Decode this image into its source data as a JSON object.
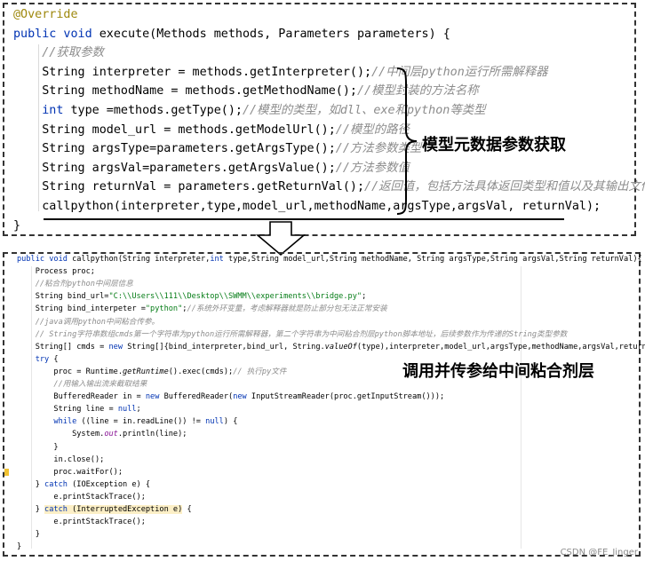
{
  "top": {
    "lines": [
      [
        {
          "c": "ann",
          "t": "@Override"
        }
      ],
      [
        {
          "c": "kw",
          "t": "public void "
        },
        {
          "c": "",
          "t": "execute(Methods methods, Parameters parameters) {"
        }
      ],
      [
        {
          "c": "",
          "t": "    "
        },
        {
          "c": "cm",
          "t": "//获取参数"
        }
      ],
      [
        {
          "c": "",
          "t": "    String interpreter = methods.getInterpreter();"
        },
        {
          "c": "cm",
          "t": "//中间层python运行所需解释器"
        }
      ],
      [
        {
          "c": "",
          "t": "    String methodName = methods.getMethodName();"
        },
        {
          "c": "cm",
          "t": "//模型封装的方法名称"
        }
      ],
      [
        {
          "c": "",
          "t": "    "
        },
        {
          "c": "kw",
          "t": "int "
        },
        {
          "c": "",
          "t": "type =methods.getType();"
        },
        {
          "c": "cm",
          "t": "//模型的类型，如dll、exe和python等类型"
        }
      ],
      [
        {
          "c": "",
          "t": "    String model_url = methods.getModelUrl();"
        },
        {
          "c": "cm",
          "t": "//模型的路径"
        }
      ],
      [
        {
          "c": "",
          "t": "    String argsType=parameters.getArgsType();"
        },
        {
          "c": "cm",
          "t": "//方法参数类型"
        }
      ],
      [
        {
          "c": "",
          "t": "    String argsVal=parameters.getArgsValue();"
        },
        {
          "c": "cm",
          "t": "//方法参数值"
        }
      ],
      [
        {
          "c": "",
          "t": "    String returnVal = parameters.getReturnVal();"
        },
        {
          "c": "cm",
          "t": "//返回值，包括方法具体返回类型和值以及其输出文件路径"
        }
      ],
      [
        {
          "c": "",
          "t": "    callpython(interpreter,type,model_url,methodName,argsType,argsVal, returnVal);"
        }
      ],
      [
        {
          "c": "",
          "t": "}"
        }
      ]
    ],
    "label": "模型元数据参数获取"
  },
  "bottom": {
    "lines": [
      [
        {
          "c": "kw",
          "t": "public void "
        },
        {
          "c": "",
          "t": "callpython(String interpreter,"
        },
        {
          "c": "kw",
          "t": "int "
        },
        {
          "c": "",
          "t": "type,String model_url,String methodName, String argsType,String argsVal,String returnVal){"
        }
      ],
      [
        {
          "c": "",
          "t": "    Process proc;"
        }
      ],
      [
        {
          "c": "",
          "t": "    "
        },
        {
          "c": "cm",
          "t": "//粘合剂python中间层信息"
        }
      ],
      [
        {
          "c": "",
          "t": "    String bind_url="
        },
        {
          "c": "st",
          "t": "\"C:\\\\Users\\\\111\\\\Desktop\\\\SWMM\\\\experiments\\\\bridge.py\""
        },
        {
          "c": "",
          "t": ";"
        }
      ],
      [
        {
          "c": "",
          "t": "    String bind_interpeter ="
        },
        {
          "c": "st",
          "t": "\"python\""
        },
        {
          "c": "",
          "t": ";"
        },
        {
          "c": "cm",
          "t": "//系统外环变量，考虑解释器就是防止部分包无法正常安装"
        }
      ],
      [
        {
          "c": "",
          "t": "    "
        },
        {
          "c": "cm",
          "t": "//java调用python中间粘合传参。"
        }
      ],
      [
        {
          "c": "",
          "t": "    "
        },
        {
          "c": "cm",
          "t": "// String字符串数组cmds第一个字符串为python运行所需解释器，第二个字符串为中间粘合剂层python脚本地址，后续参数作为传递的String类型参数"
        }
      ],
      [
        {
          "c": "",
          "t": "    String[] cmds = "
        },
        {
          "c": "kw",
          "t": "new "
        },
        {
          "c": "",
          "t": "String[]{bind_interpreter,bind_url, String."
        },
        {
          "c": "it",
          "t": "valueOf"
        },
        {
          "c": "",
          "t": "(type),interpreter,model_url,argsType,methodName,argsVal,returnVal};"
        }
      ],
      [
        {
          "c": "",
          "t": "    "
        },
        {
          "c": "kw",
          "t": "try "
        },
        {
          "c": "",
          "t": "{"
        }
      ],
      [
        {
          "c": "",
          "t": "        proc = Runtime."
        },
        {
          "c": "it",
          "t": "getRuntime"
        },
        {
          "c": "",
          "t": "().exec(cmds);"
        },
        {
          "c": "cm",
          "t": "// 执行py文件"
        }
      ],
      [
        {
          "c": "",
          "t": "        "
        },
        {
          "c": "cm",
          "t": "//用输入输出流来截取结果"
        }
      ],
      [
        {
          "c": "",
          "t": "        BufferedReader in = "
        },
        {
          "c": "kw",
          "t": "new "
        },
        {
          "c": "",
          "t": "BufferedReader("
        },
        {
          "c": "kw",
          "t": "new "
        },
        {
          "c": "",
          "t": "InputStreamReader(proc.getInputStream()));"
        }
      ],
      [
        {
          "c": "",
          "t": "        String line = "
        },
        {
          "c": "kw",
          "t": "null"
        },
        {
          "c": "",
          "t": ";"
        }
      ],
      [
        {
          "c": "",
          "t": "        "
        },
        {
          "c": "kw",
          "t": "while "
        },
        {
          "c": "",
          "t": "((line = in.readLine()) != "
        },
        {
          "c": "kw",
          "t": "null"
        },
        {
          "c": "",
          "t": ") {"
        }
      ],
      [
        {
          "c": "",
          "t": "            System."
        },
        {
          "c": "pu",
          "t": "out"
        },
        {
          "c": "",
          "t": ".println(line);"
        }
      ],
      [
        {
          "c": "",
          "t": "        }"
        }
      ],
      [
        {
          "c": "",
          "t": "        in.close();"
        }
      ],
      [
        {
          "c": "",
          "t": "        proc.waitFor();"
        }
      ],
      [
        {
          "c": "",
          "t": "    } "
        },
        {
          "c": "kw",
          "t": "catch "
        },
        {
          "c": "",
          "t": "(IOException e) {"
        }
      ],
      [
        {
          "c": "",
          "t": "        e.printStackTrace();"
        }
      ],
      [
        {
          "c": "",
          "t": "    } "
        },
        {
          "c": "kw hl",
          "t": "catch "
        },
        {
          "c": "hl",
          "t": "(InterruptedException e)"
        },
        {
          "c": "",
          "t": " {"
        }
      ],
      [
        {
          "c": "",
          "t": "        e.printStackTrace();"
        }
      ],
      [
        {
          "c": "",
          "t": "    }"
        }
      ],
      [
        {
          "c": "",
          "t": "}"
        }
      ]
    ],
    "label": "调用并传参给中间粘合剂层"
  },
  "watermark": "CSDN @FE_Jinger"
}
